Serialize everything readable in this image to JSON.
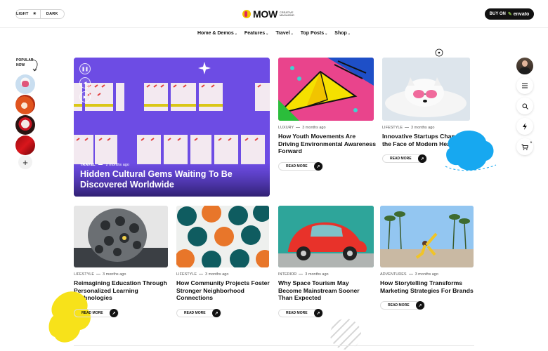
{
  "header": {
    "mode_light": "LIGHT",
    "mode_dark": "DARK",
    "logo_text": "MOW",
    "logo_sub_1": "CREATIVE",
    "logo_sub_2": "MAGAZINE",
    "buy_prefix": "BUY ON",
    "buy_brand": "envato"
  },
  "nav": [
    {
      "label": "Home & Demos"
    },
    {
      "label": "Features"
    },
    {
      "label": "Travel"
    },
    {
      "label": "Top Posts"
    },
    {
      "label": "Shop"
    }
  ],
  "sidebar_left": {
    "label_1": "POPULAR",
    "label_2": "NOW",
    "plus": "+"
  },
  "hero": {
    "category": "TRAVEL",
    "time": "2 months ago",
    "title": "Hidden Cultural Gems Waiting To Be Discovered Worldwide",
    "background": "#6d4ce4"
  },
  "cards": [
    {
      "category": "LUXURY",
      "time": "3 months ago",
      "title": "How Youth Movements Are Driving Environmental Awareness Forward",
      "read_more": "READ MORE"
    },
    {
      "category": "LIFESTYLE",
      "time": "3 months ago",
      "title": "Innovative Startups Changing the Face of Modern Healthcare",
      "read_more": "READ MORE"
    },
    {
      "category": "LIFESTYLE",
      "time": "3 months ago",
      "title": "Reimagining Education Through Personalized Learning Technologies",
      "read_more": "READ MORE"
    },
    {
      "category": "LIFESTYLE",
      "time": "3 months ago",
      "title": "How Community Projects Foster Stronger Neighborhood Connections",
      "read_more": "READ MORE"
    },
    {
      "category": "INTERIOR",
      "time": "3 months ago",
      "title": "Why Space Tourism May Become Mainstream Sooner Than Expected",
      "read_more": "READ MORE"
    },
    {
      "category": "ADVENTURES",
      "time": "3 months ago",
      "title": "How Storytelling Transforms Marketing Strategies For Brands",
      "read_more": "READ MORE"
    }
  ],
  "colors": {
    "accent_blue": "#17a8f0",
    "accent_yellow": "#f7e21a",
    "dark": "#111111"
  }
}
